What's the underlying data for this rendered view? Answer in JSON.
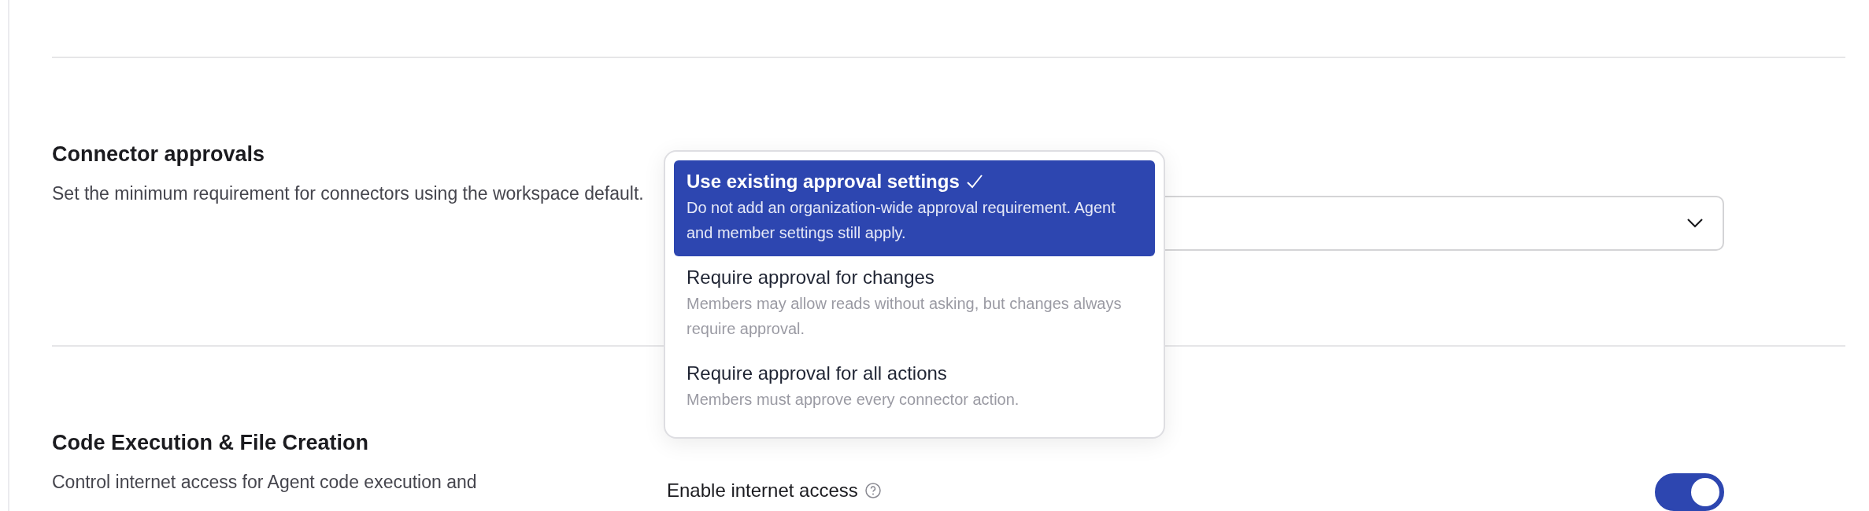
{
  "sections": [
    {
      "kind": "select",
      "title": "Connector approvals",
      "description": "Set the minimum requirement for connectors using the workspace default.",
      "expanded": true,
      "options": [
        {
          "label": "Use existing approval settings",
          "description": "Do not add an organization-wide approval requirement. Agent and member settings still apply.",
          "selected": true
        },
        {
          "label": "Require approval for changes",
          "description": "Members may allow reads without asking, but changes always require approval.",
          "selected": false
        },
        {
          "label": "Require approval for all actions",
          "description": "Members must approve every connector action.",
          "selected": false
        }
      ]
    },
    {
      "kind": "toggles",
      "title": "Code Execution & File Creation",
      "description": "Control internet access for Agent code execution and",
      "settings": [
        {
          "label": "Enable internet access",
          "on": true
        }
      ]
    }
  ]
}
